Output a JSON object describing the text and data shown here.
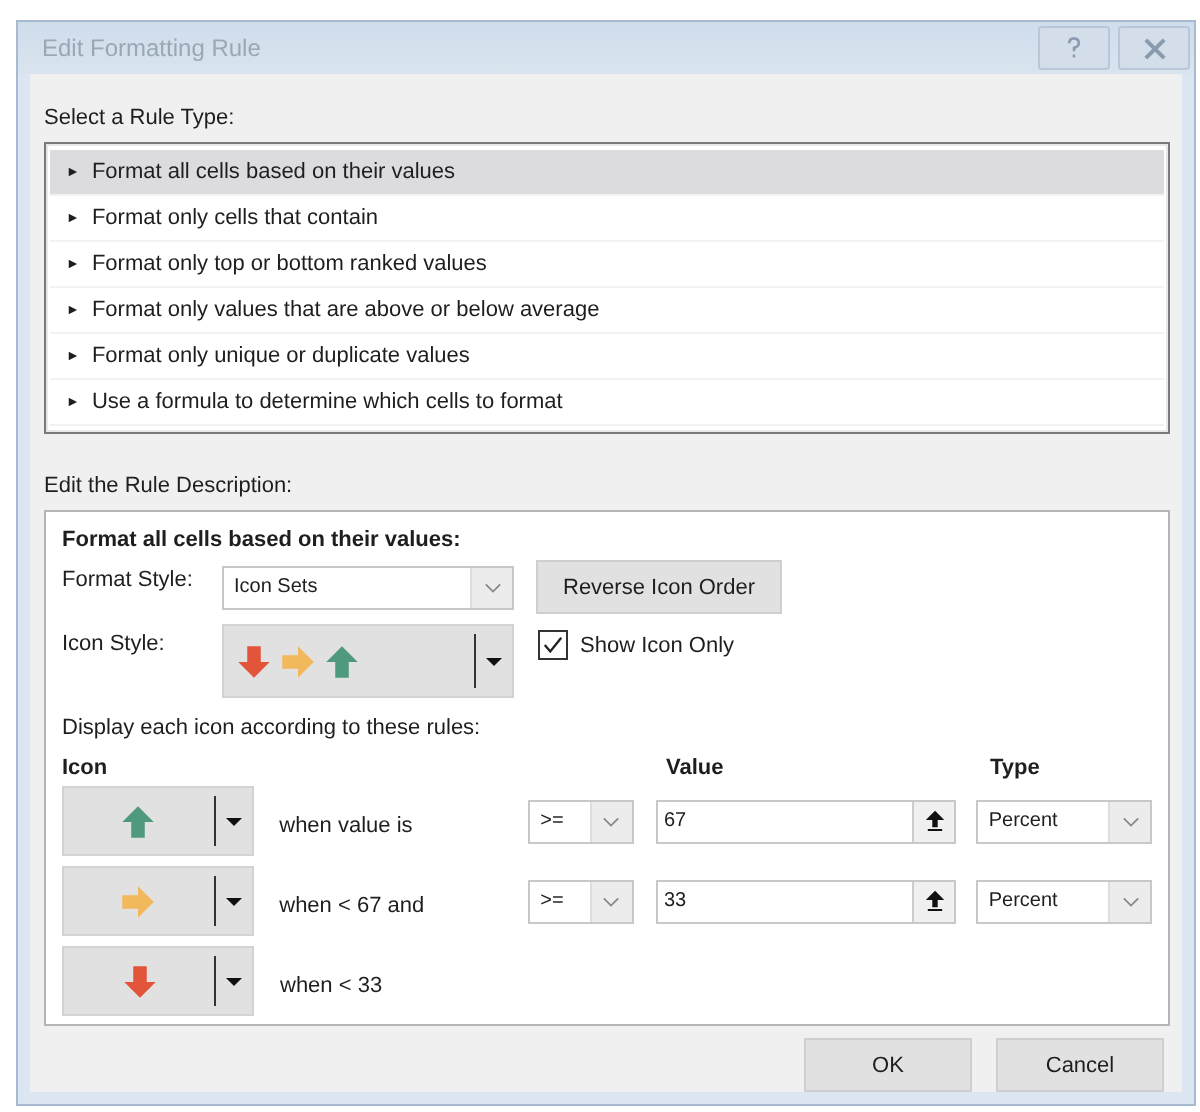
{
  "window": {
    "title": "Edit Formatting Rule"
  },
  "rule_type": {
    "label": "Select a Rule Type:",
    "items": [
      {
        "marker": "►",
        "text": "Format all cells based on their values",
        "selected": true
      },
      {
        "marker": "►",
        "text": "Format only cells that contain",
        "selected": false
      },
      {
        "marker": "►",
        "text": "Format only top or bottom ranked values",
        "selected": false
      },
      {
        "marker": "►",
        "text": "Format only values that are above or below average",
        "selected": false
      },
      {
        "marker": "►",
        "text": "Format only unique or duplicate values",
        "selected": false
      },
      {
        "marker": "►",
        "text": "Use a formula to determine which cells to format",
        "selected": false
      }
    ]
  },
  "description": {
    "label": "Edit the Rule Description:",
    "heading": "Format all cells based on their values:",
    "format_style": {
      "label": "Format Style:",
      "value": "Icon Sets"
    },
    "reverse_button": "Reverse Icon Order",
    "icon_style": {
      "label": "Icon Style:",
      "icons": [
        {
          "kind": "down"
        },
        {
          "kind": "right"
        },
        {
          "kind": "up"
        }
      ]
    },
    "show_icon_only": {
      "label": "Show Icon Only",
      "checked": true
    },
    "display_label": "Display each icon according to these rules:",
    "columns": {
      "icon": "Icon",
      "value": "Value",
      "type": "Type"
    },
    "rules": [
      {
        "kind": "up",
        "condition": "when value is",
        "operator": ">=",
        "value": "67",
        "type": "Percent"
      },
      {
        "kind": "right",
        "condition": "when < 67 and",
        "operator": ">=",
        "value": "33",
        "type": "Percent"
      },
      {
        "kind": "down",
        "condition": "when < 33"
      }
    ]
  },
  "buttons": [
    "OK",
    "Cancel"
  ]
}
